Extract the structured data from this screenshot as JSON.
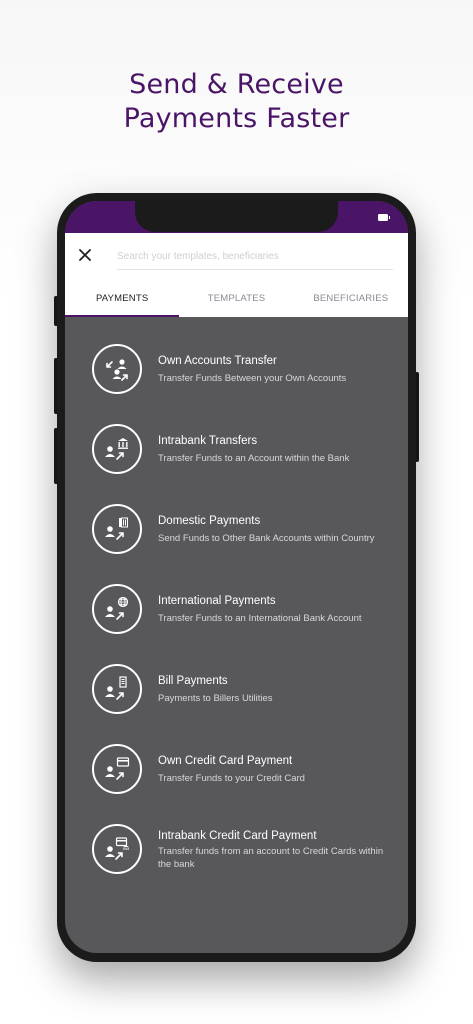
{
  "headline": {
    "line1": "Send & Receive",
    "line2": "Payments Faster"
  },
  "search": {
    "placeholder": "Search your templates, beneficiaries"
  },
  "tabs": [
    {
      "label": "PAYMENTS",
      "active": true
    },
    {
      "label": "TEMPLATES",
      "active": false
    },
    {
      "label": "BENEFICIARIES",
      "active": false
    }
  ],
  "payments": [
    {
      "title": "Own Accounts Transfer",
      "subtitle": "Transfer Funds Between your Own Accounts",
      "icon": "own-accounts-transfer-icon"
    },
    {
      "title": "Intrabank Transfers",
      "subtitle": "Transfer Funds to an Account within the Bank",
      "icon": "bank-transfer-icon"
    },
    {
      "title": "Domestic Payments",
      "subtitle": "Send Funds to Other Bank Accounts within Country",
      "icon": "domestic-payment-icon"
    },
    {
      "title": "International Payments",
      "subtitle": "Transfer Funds to an International Bank Account",
      "icon": "globe-transfer-icon"
    },
    {
      "title": "Bill Payments",
      "subtitle": "Payments to Billers Utilities",
      "icon": "bill-payment-icon"
    },
    {
      "title": "Own Credit Card Payment",
      "subtitle": "Transfer Funds to your Credit Card",
      "icon": "credit-card-icon"
    },
    {
      "title": "Intrabank Credit Card Payment",
      "subtitle": "Transfer funds from an account to Credit Cards within the bank",
      "icon": "bank-credit-card-icon"
    }
  ],
  "colors": {
    "brand": "#4a1566",
    "screen_bg": "#58585b",
    "active_tab_underline": "#4a1566"
  }
}
